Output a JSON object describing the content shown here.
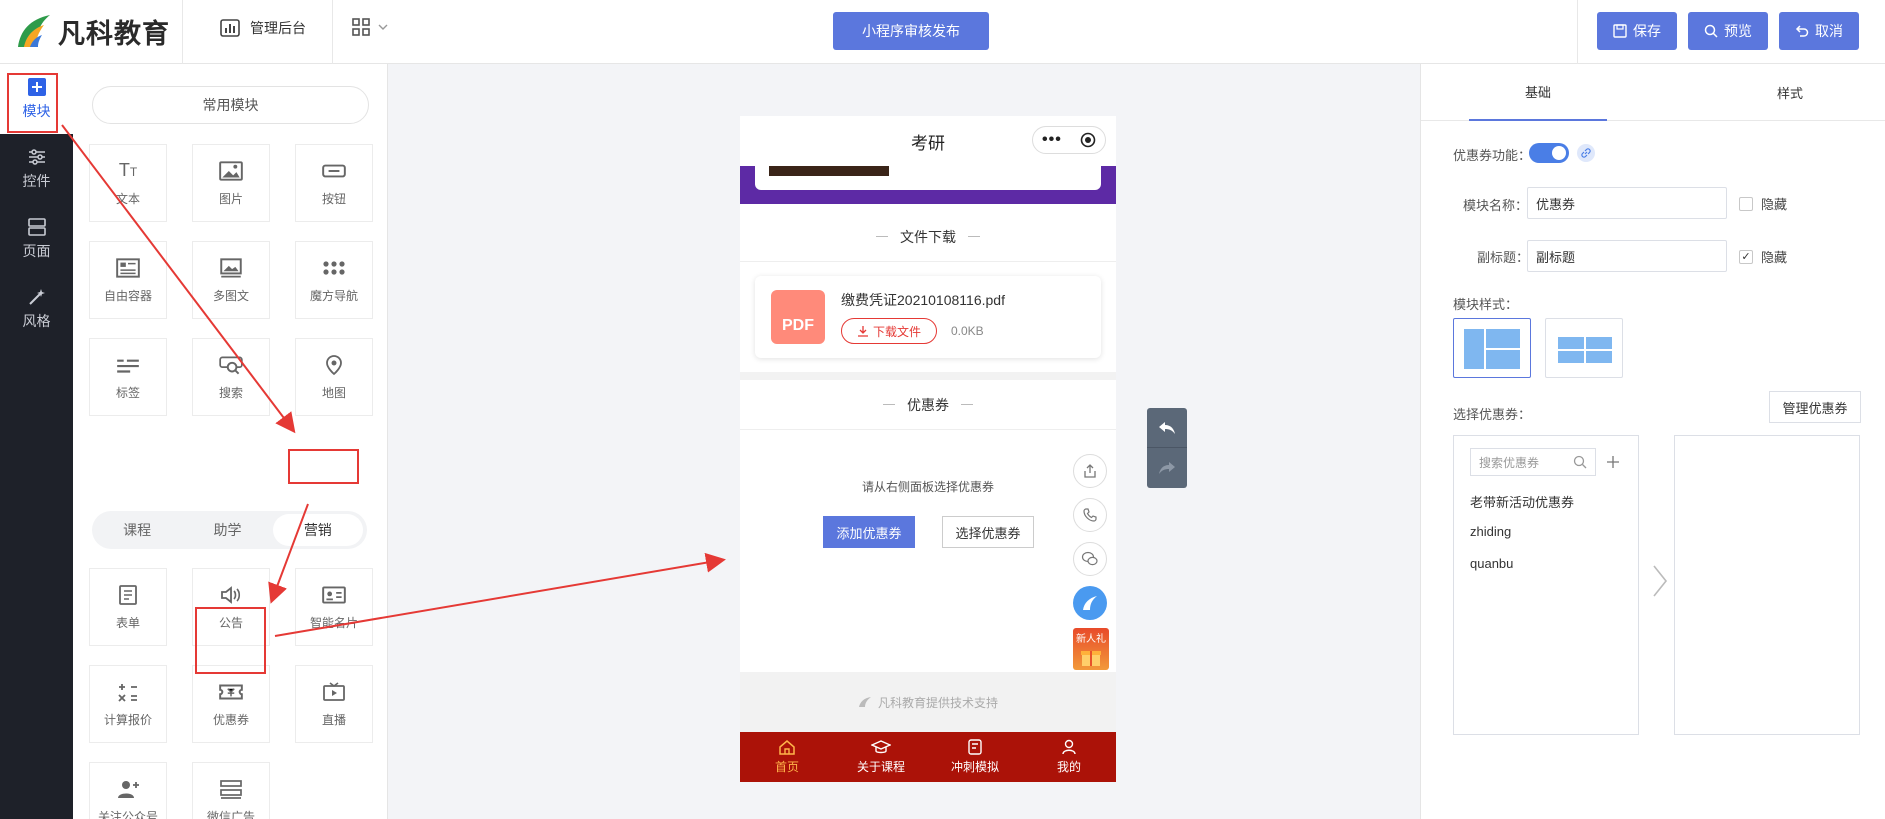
{
  "header": {
    "brand": "凡科教育",
    "admin_label": "管理后台",
    "publish_label": "小程序审核发布",
    "save_label": "保存",
    "preview_label": "预览",
    "cancel_label": "取消"
  },
  "sidebar": {
    "items": [
      {
        "label": "模块",
        "icon": "plus-square-icon"
      },
      {
        "label": "控件",
        "icon": "sliders-icon"
      },
      {
        "label": "页面",
        "icon": "pages-icon"
      },
      {
        "label": "风格",
        "icon": "magic-wand-icon"
      }
    ]
  },
  "modules": {
    "common_label": "常用模块",
    "common": [
      {
        "label": "文本",
        "icon": "text-icon"
      },
      {
        "label": "图片",
        "icon": "image-icon"
      },
      {
        "label": "按钮",
        "icon": "button-icon"
      },
      {
        "label": "自由容器",
        "icon": "container-icon"
      },
      {
        "label": "多图文",
        "icon": "multi-image-icon"
      },
      {
        "label": "魔方导航",
        "icon": "cube-nav-icon"
      },
      {
        "label": "标签",
        "icon": "tag-icon"
      },
      {
        "label": "搜索",
        "icon": "search-icon"
      },
      {
        "label": "地图",
        "icon": "map-pin-icon"
      }
    ],
    "tabs": [
      "课程",
      "助学",
      "营销"
    ],
    "marketing": [
      {
        "label": "表单",
        "icon": "form-icon"
      },
      {
        "label": "公告",
        "icon": "speaker-icon"
      },
      {
        "label": "智能名片",
        "icon": "card-icon"
      },
      {
        "label": "计算报价",
        "icon": "calculator-icon"
      },
      {
        "label": "优惠券",
        "icon": "coupon-icon"
      },
      {
        "label": "直播",
        "icon": "live-icon"
      },
      {
        "label": "关注公众号",
        "icon": "follow-user-icon"
      },
      {
        "label": "微信广告",
        "icon": "ad-icon"
      }
    ]
  },
  "phone": {
    "title": "考研",
    "file_section_title": "文件下载",
    "file_name": "缴费凭证20210108116.pdf",
    "file_badge": "PDF",
    "download_label": "下载文件",
    "file_size": "0.0KB",
    "coupon_section_title": "优惠券",
    "coupon_hint": "请从右侧面板选择优惠券",
    "add_coupon_label": "添加优惠券",
    "select_coupon_label": "选择优惠券",
    "gift_label": "新人礼",
    "footer_support": "凡科教育提供技术支持",
    "tabbar": [
      "首页",
      "关于课程",
      "冲刺模拟",
      "我的"
    ]
  },
  "settings": {
    "tabs": [
      "基础",
      "样式"
    ],
    "coupon_feature_label": "优惠券功能：",
    "module_name_label": "模块名称：",
    "module_name_value": "优惠券",
    "subtitle_label": "副标题：",
    "subtitle_value": "副标题",
    "hide_label": "隐藏",
    "module_style_label": "模块样式：",
    "select_coupon_label": "选择优惠券：",
    "manage_coupon_label": "管理优惠券",
    "search_placeholder": "搜索优惠券",
    "coupon_list": [
      "老带新活动优惠券",
      "zhiding",
      "quanbu"
    ]
  },
  "colors": {
    "accent": "#5b77dd",
    "tabbar": "#ab1208",
    "annotation": "#e53935"
  }
}
